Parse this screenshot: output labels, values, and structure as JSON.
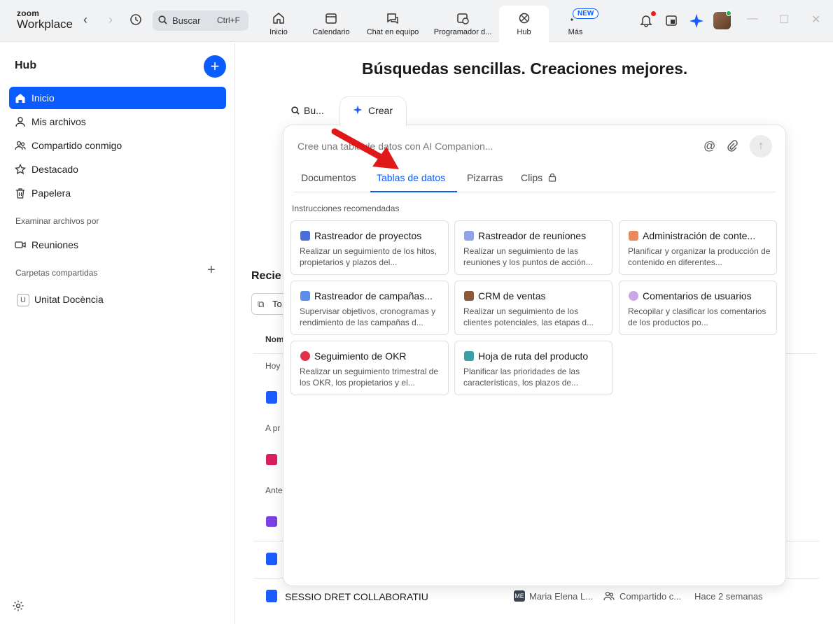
{
  "app": {
    "logo_top": "zoom",
    "logo_bottom": "Workplace",
    "search_placeholder": "Buscar",
    "search_shortcut": "Ctrl+F"
  },
  "nav_tabs": [
    {
      "label": "Inicio",
      "icon": "home-icon"
    },
    {
      "label": "Calendario",
      "icon": "calendar-icon"
    },
    {
      "label": "Chat en equipo",
      "icon": "chat-icon"
    },
    {
      "label": "Programador d...",
      "icon": "scheduler-icon"
    },
    {
      "label": "Hub",
      "icon": "hub-icon",
      "active": true
    },
    {
      "label": "Más",
      "icon": "more-icon",
      "badge": "NEW"
    }
  ],
  "colors": {
    "accent": "#0b5cff",
    "notification": "#e02020",
    "presence": "#21b24b",
    "arrow": "#e01818"
  },
  "sidebar": {
    "title": "Hub",
    "items": [
      {
        "label": "Inicio",
        "icon": "home-icon",
        "active": true
      },
      {
        "label": "Mis archivos",
        "icon": "person-icon"
      },
      {
        "label": "Compartido conmigo",
        "icon": "people-icon"
      },
      {
        "label": "Destacado",
        "icon": "star-icon"
      },
      {
        "label": "Papelera",
        "icon": "trash-icon"
      }
    ],
    "browse_section": "Examinar archivos por",
    "browse_items": [
      {
        "label": "Reuniones",
        "icon": "video-icon"
      }
    ],
    "shared_section": "Carpetas compartidas",
    "shared_folders": [
      {
        "badge": "U",
        "label": "Unitat Docència"
      }
    ]
  },
  "main": {
    "headline": "Búsquedas sencillas. Creaciones mejores.",
    "mode_search": "Bu...",
    "mode_create": "Crear",
    "bg_recent": "Recie",
    "bg_filter": "To",
    "bg_col_name": "Nom",
    "bg_groups": [
      "Hoy",
      "A pr",
      "Ante"
    ],
    "last_row": {
      "name": "SESSIO DRET COLLABORATIU",
      "owner_initials": "ME",
      "owner": "Maria Elena L...",
      "shared": "Compartido c...",
      "time": "Hace 2 semanas"
    }
  },
  "create_panel": {
    "prompt_placeholder": "Cree una tabla de datos con AI Companion...",
    "tabs": [
      "Documentos",
      "Tablas de datos",
      "Pizarras",
      "Clips"
    ],
    "active_tab": "Tablas de datos",
    "recommended_label": "Instrucciones recomendadas",
    "tiles": [
      {
        "title": "Rastreador de proyectos",
        "desc": "Realizar un seguimiento de los hitos, propietarios y plazos del...",
        "icon": "chart-icon"
      },
      {
        "title": "Rastreador de reuniones",
        "desc": "Realizar un seguimiento de las reuniones y los puntos de acción...",
        "icon": "calendar-icon"
      },
      {
        "title": "Administración de conte...",
        "desc": "Planificar y organizar la producción de contenido en diferentes...",
        "icon": "memo-icon"
      },
      {
        "title": "Rastreador de campañas...",
        "desc": "Supervisar objetivos, cronogramas y rendimiento de las campañas d...",
        "icon": "trend-icon"
      },
      {
        "title": "CRM de ventas",
        "desc": "Realizar un seguimiento de los clientes potenciales, las etapas d...",
        "icon": "briefcase-icon"
      },
      {
        "title": "Comentarios de usuarios",
        "desc": "Recopilar y clasificar los comentarios de los productos po...",
        "icon": "speech-icon"
      },
      {
        "title": "Seguimiento de OKR",
        "desc": "Realizar un seguimiento trimestral de los OKR, los propietarios y el...",
        "icon": "target-icon"
      },
      {
        "title": "Hoja de ruta del producto",
        "desc": "Planificar las prioridades de las características, los plazos de...",
        "icon": "map-icon"
      }
    ]
  }
}
